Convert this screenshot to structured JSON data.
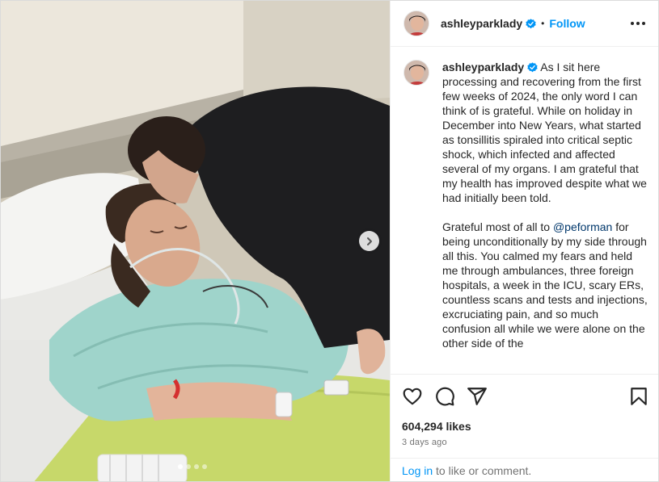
{
  "post": {
    "username": "ashleyparklady",
    "verified": true,
    "separator": "•",
    "follow_label": "Follow",
    "more_icon": "more-horizontal-icon"
  },
  "media": {
    "description_icon": "photo",
    "slide_count": 4,
    "active_slide": 1,
    "next_icon": "chevron-right-icon"
  },
  "caption": {
    "username": "ashleyparklady",
    "paragraph1": " As I sit here processing and recovering from the first few weeks of 2024, the only word I can think of is grateful. While on holiday in December into New Years, what started as tonsillitis spiraled into critical septic shock, which infected and affected several of my organs. I am grateful that my health has improved despite what we had initially been told.",
    "paragraph2_before": "Grateful most of all to ",
    "mention": "@peforman",
    "paragraph2_after": " for being unconditionally by my side through all this. You calmed my fears and held me through ambulances, three foreign hospitals, a week in the ICU, scary ERs, countless scans and tests and injections, excruciating pain, and so much confusion all while we were alone on the other side of the"
  },
  "actions": {
    "like_icon": "heart-icon",
    "comment_icon": "comment-icon",
    "share_icon": "share-icon",
    "save_icon": "bookmark-icon"
  },
  "stats": {
    "likes": "604,294 likes",
    "time_ago": "3 days ago"
  },
  "login": {
    "link_label": "Log in",
    "suffix": " to like or comment."
  },
  "colors": {
    "accent": "#0095f6",
    "mention": "#00376b",
    "muted": "#737373",
    "text": "#262626"
  }
}
